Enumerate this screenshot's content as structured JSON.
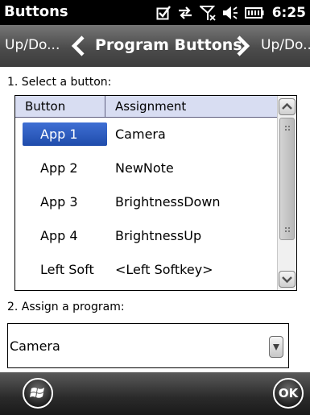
{
  "status_bar": {
    "app_title": "Buttons",
    "icons": [
      "checkbox-icon",
      "sync-arrows-icon",
      "no-signal-icon",
      "speaker-icon",
      "battery-icon"
    ],
    "time": "6:25"
  },
  "nav": {
    "left_label": "Up/Do...",
    "title": "Program Buttons",
    "right_label": "Up/Do..."
  },
  "step1_label": "1. Select a button:",
  "list": {
    "columns": [
      "Button",
      "Assignment"
    ],
    "rows": [
      {
        "button": "App 1",
        "assignment": "Camera",
        "selected": true
      },
      {
        "button": "App 2",
        "assignment": "NewNote",
        "selected": false
      },
      {
        "button": "App 3",
        "assignment": "BrightnessDown",
        "selected": false
      },
      {
        "button": "App 4",
        "assignment": "BrightnessUp",
        "selected": false
      },
      {
        "button": "Left Soft",
        "assignment": "<Left Softkey>",
        "selected": false
      }
    ]
  },
  "step2_label": "2. Assign a program:",
  "program_combo": {
    "value": "Camera"
  },
  "softkeys": {
    "start_icon": "windows-flag-icon",
    "ok_label": "OK"
  },
  "colors": {
    "status_bar": "#000000",
    "nav_bar": "#4c4c4c",
    "selection": "#2a57bf",
    "header_row": "#d8ddf2",
    "soft_bar": "#2a2a2a"
  }
}
